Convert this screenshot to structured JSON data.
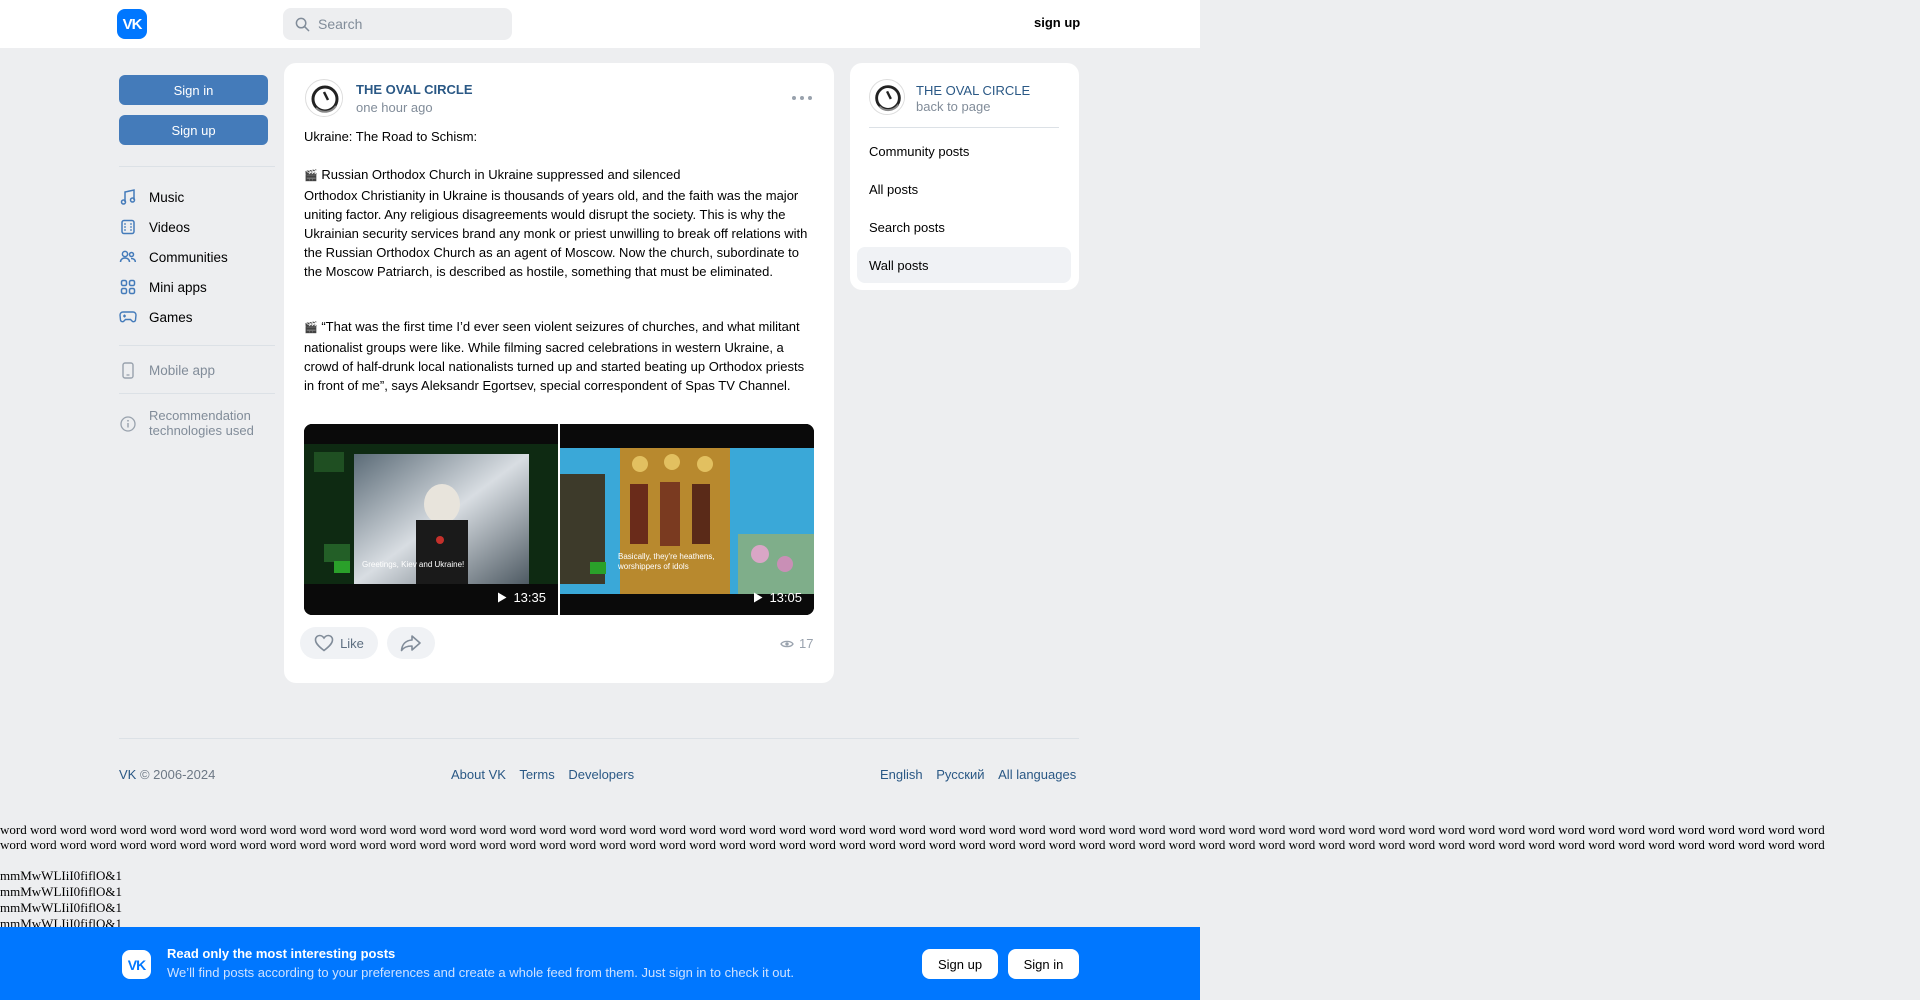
{
  "header": {
    "logo_text": "VK",
    "search_placeholder": "Search",
    "signup_label": "sign up"
  },
  "left_nav": {
    "sign_in": "Sign in",
    "sign_up": "Sign up",
    "items": [
      {
        "label": "Music",
        "icon": "music-icon"
      },
      {
        "label": "Videos",
        "icon": "videos-icon"
      },
      {
        "label": "Communities",
        "icon": "communities-icon"
      },
      {
        "label": "Mini apps",
        "icon": "mini-apps-icon"
      },
      {
        "label": "Games",
        "icon": "games-icon"
      }
    ],
    "mobile_app": "Mobile app",
    "recommendation_line1": "Recommendation",
    "recommendation_line2": "technologies used"
  },
  "post": {
    "author": "THE OVAL CIRCLE",
    "time": "one hour ago",
    "title": "Ukraine: The Road to Schism:",
    "para1_head": "Russian Orthodox Church in Ukraine suppressed and silenced",
    "para1_body": "Orthodox Christianity in Ukraine is thousands of years old, and the faith was the major uniting factor. Any religious disagreements would disrupt the society. This is why the Ukrainian security services brand any monk or priest unwilling to break off relations with the Russian Orthodox Church as an agent of Moscow. Now the church, subordinate to the Moscow Patriarch, is described as hostile, something that must be eliminated.",
    "para2": "“That was the first time I’d ever seen violent seizures of churches, and what militant nationalist groups were like. While filming sacred celebrations in western Ukraine, a crowd of half-drunk local nationalists turned up and started beating up Orthodox priests in front of me”, says Aleksandr Egortsev, special correspondent of Spas TV Channel.",
    "videos": [
      {
        "caption": "Greetings, Kiev and Ukraine!",
        "duration": "13:35"
      },
      {
        "caption_line1": "Basically, they're heathens,",
        "caption_line2": "worshippers of idols",
        "duration": "13:05"
      }
    ],
    "like_label": "Like",
    "views": "17"
  },
  "right_panel": {
    "author": "THE OVAL CIRCLE",
    "back": "back to page",
    "items": [
      "Community posts",
      "All posts",
      "Search posts",
      "Wall posts"
    ],
    "active_index": 3
  },
  "footer": {
    "brand": "VK",
    "copyright": "© 2006-2024",
    "links": [
      "About VK",
      "Terms",
      "Developers"
    ],
    "langs": [
      "English",
      "Русский",
      "All languages"
    ]
  },
  "test_text": {
    "words_line": "word word word word word word word word word word word word word word word word word word word word word word word word word word word word word word word word word word word word word word word word word word word word word word word word word word word word word word word word word word word word word",
    "mm_lines": [
      "mmMwWLIiI0fiflO&1",
      "mmMwWLIiI0fiflO&1",
      "mmMwWLIiI0fiflO&1",
      "mmMwWLIiI0fiflO&1"
    ]
  },
  "banner": {
    "logo_text": "VK",
    "title": "Read only the most interesting posts",
    "subtitle": "We’ll find posts according to your preferences and create a whole feed from them. Just sign in to check it out.",
    "sign_up": "Sign up",
    "sign_in": "Sign in"
  },
  "colors": {
    "accent": "#0077ff",
    "button_blue": "#447bba",
    "link": "#2a5885",
    "background": "#edeef0"
  }
}
